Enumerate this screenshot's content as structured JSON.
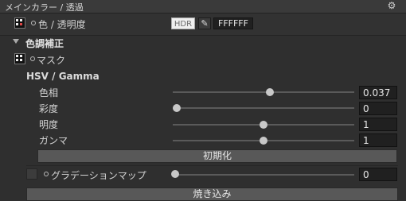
{
  "header": {
    "title": "メインカラー / 透過",
    "settings_icon": "gear-icon"
  },
  "main_color": {
    "label": "色 / 透明度",
    "hdr_label": "HDR",
    "eyedropper_icon": "eyedropper-icon",
    "hex_value": "FFFFFF"
  },
  "color_correction": {
    "title": "色調補正",
    "mask_label": "マスク",
    "hsv_title": "HSV / Gamma",
    "sliders": [
      {
        "label": "色相",
        "value": "0.037",
        "fraction": 0.52
      },
      {
        "label": "彩度",
        "value": "0",
        "fraction": 0.0
      },
      {
        "label": "明度",
        "value": "1",
        "fraction": 0.5
      },
      {
        "label": "ガンマ",
        "value": "1",
        "fraction": 0.5
      }
    ],
    "reset_button": "初期化",
    "gradation": {
      "label": "グラデーションマップ",
      "value": "0",
      "fraction": 0.0
    },
    "bake_button": "焼き込み"
  }
}
